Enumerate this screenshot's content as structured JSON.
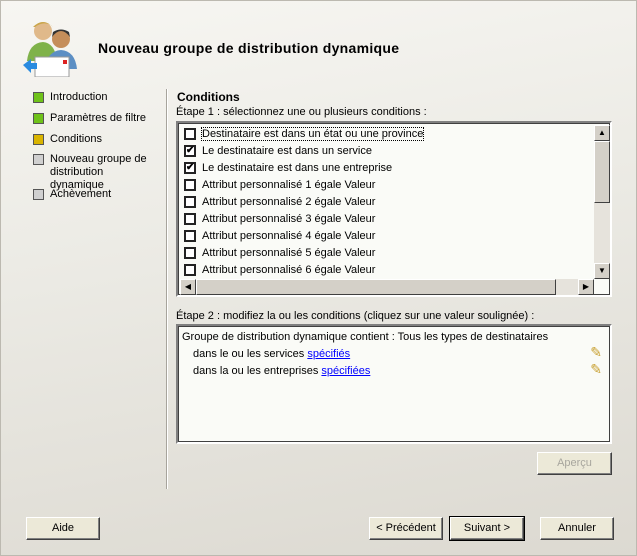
{
  "header": {
    "title": "Nouveau groupe de distribution dynamique",
    "icon": "users-mail-icon"
  },
  "nav": [
    {
      "label": "Introduction",
      "status": "done",
      "color": "#6fc21a"
    },
    {
      "label": "Paramètres de filtre",
      "status": "done",
      "color": "#6fc21a"
    },
    {
      "label": "Conditions",
      "status": "current",
      "color": "#d9b400"
    },
    {
      "label": "Nouveau groupe de distribution dynamique",
      "status": "pending",
      "color": "#d0d0d0"
    },
    {
      "label": "Achèvement",
      "status": "pending",
      "color": "#d0d0d0"
    }
  ],
  "main": {
    "heading": "Conditions",
    "step1_label": "Étape 1 : sélectionnez une ou plusieurs conditions :",
    "conditions": [
      {
        "label": "Destinataire est dans un état ou une province",
        "checked": false
      },
      {
        "label": "Le destinataire est dans un service",
        "checked": true
      },
      {
        "label": "Le destinataire est dans une entreprise",
        "checked": true
      },
      {
        "label": "Attribut personnalisé 1 égale Valeur",
        "checked": false
      },
      {
        "label": "Attribut personnalisé 2 égale Valeur",
        "checked": false
      },
      {
        "label": "Attribut personnalisé 3 égale Valeur",
        "checked": false
      },
      {
        "label": "Attribut personnalisé 4 égale Valeur",
        "checked": false
      },
      {
        "label": "Attribut personnalisé 5 égale Valeur",
        "checked": false
      },
      {
        "label": "Attribut personnalisé 6 égale Valeur",
        "checked": false
      }
    ],
    "step2_label": "Étape 2 : modifiez la ou les conditions (cliquez sur une valeur soulignée) :",
    "summary": {
      "line1": "Groupe de distribution dynamique contient : Tous les types de destinataires",
      "line2_text": "dans le ou les services ",
      "line2_link": "spécifiés",
      "line3_text": "dans la ou les entreprises ",
      "line3_link": "spécifiées"
    },
    "preview_label": "Aperçu"
  },
  "footer": {
    "help": "Aide",
    "back": "< Précédent",
    "next": "Suivant >",
    "cancel": "Annuler"
  }
}
